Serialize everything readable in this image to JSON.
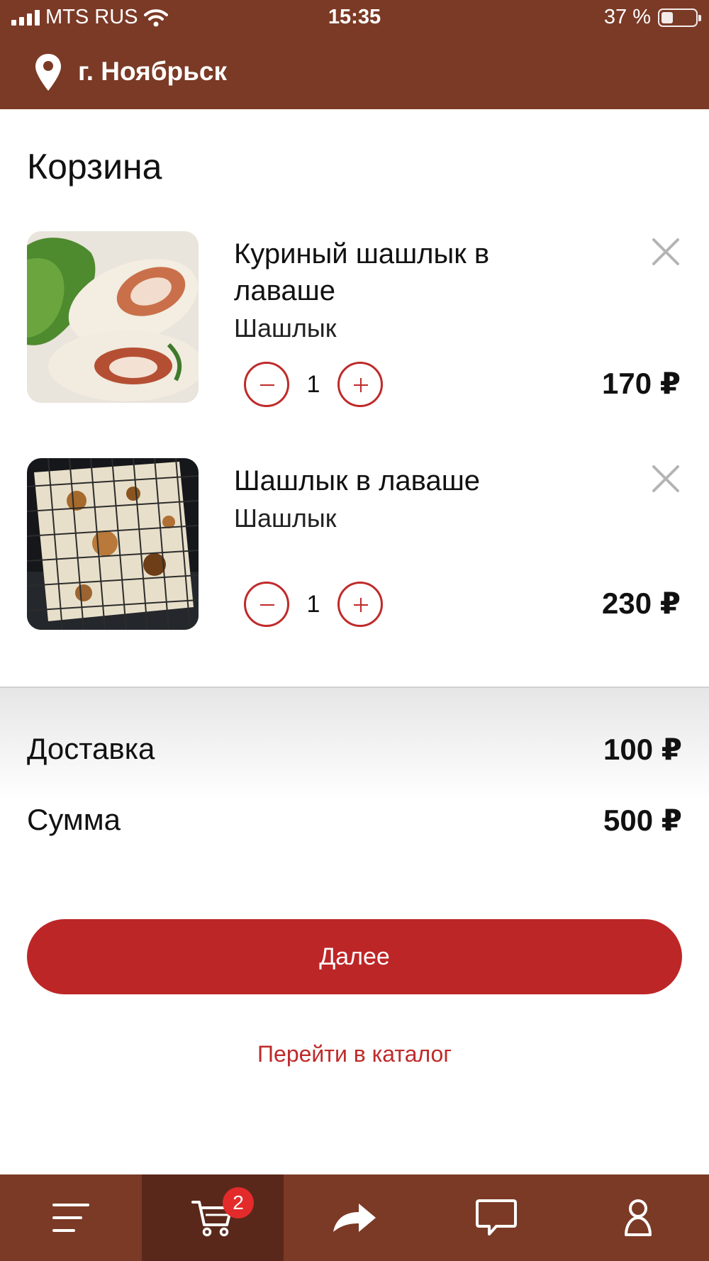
{
  "status_bar": {
    "carrier": "MTS RUS",
    "time": "15:35",
    "battery": "37 %",
    "battery_level": 0.37
  },
  "header": {
    "city": "г. Ноябрьск",
    "icon": "map-pin-icon"
  },
  "page": {
    "title": "Корзина"
  },
  "cart": {
    "items": [
      {
        "name": "Куриный шашлык в лаваше",
        "category": "Шашлык",
        "quantity": "1",
        "price": "170 ₽",
        "image": "chicken-shawarma-photo"
      },
      {
        "name": "Шашлык в лаваше",
        "category": "Шашлык",
        "quantity": "1",
        "price": "230 ₽",
        "image": "grilled-lavash-photo"
      }
    ]
  },
  "summary": {
    "delivery_label": "Доставка",
    "delivery_value": "100 ₽",
    "total_label": "Сумма",
    "total_value": "500 ₽"
  },
  "actions": {
    "next_label": "Далее",
    "catalog_label": "Перейти в каталог"
  },
  "tabbar": {
    "tabs": [
      {
        "icon": "menu-icon"
      },
      {
        "icon": "cart-icon",
        "badge": "2",
        "active": true
      },
      {
        "icon": "share-icon"
      },
      {
        "icon": "chat-icon"
      },
      {
        "icon": "profile-icon"
      }
    ]
  },
  "colors": {
    "brand": "#7b3a26",
    "accent": "#bd2627"
  }
}
